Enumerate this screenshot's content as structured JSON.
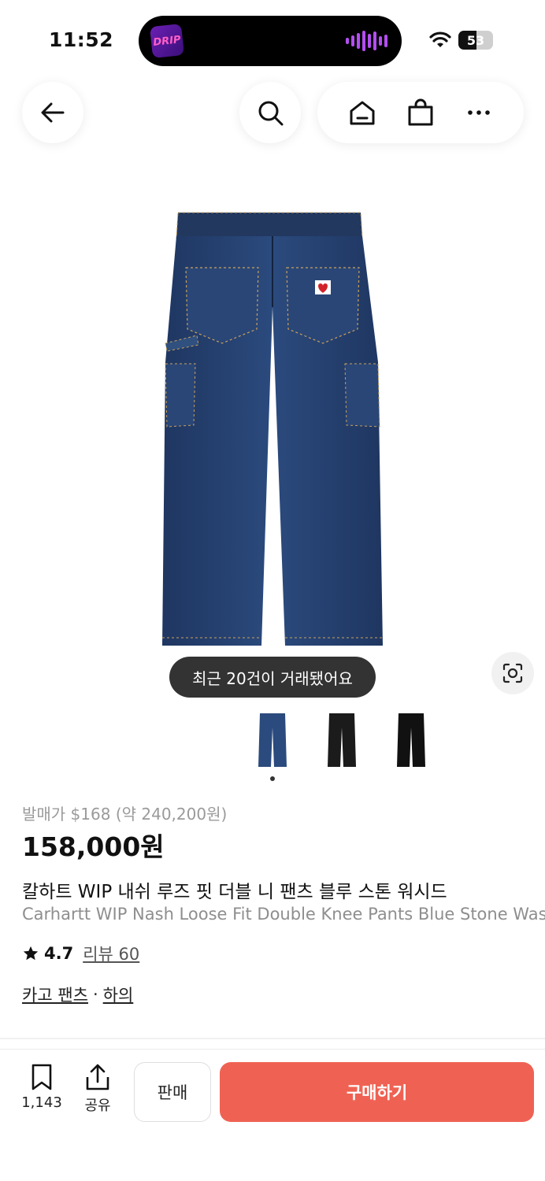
{
  "status_bar": {
    "time": "11:52",
    "island_app": "DRIP",
    "battery_percent": 53,
    "battery_text": "53"
  },
  "nav": {
    "back_icon": "arrow-left-icon",
    "search_icon": "search-icon",
    "home_icon": "home-icon",
    "cart_icon": "shopping-bag-icon",
    "more_icon": "more-horizontal-icon"
  },
  "product": {
    "toast": "최근 20건이 거래됐어요",
    "thumbnails": [
      "blue",
      "black",
      "black"
    ],
    "release_price": "발매가 $168 (약 240,200원)",
    "price": "158,000원",
    "name_ko": "칼하트 WIP 내쉬 루즈 핏 더블 니 팬츠 블루 스톤 워시드",
    "name_en": "Carhartt WIP Nash Loose Fit Double Knee Pants Blue Stone Washed",
    "rating": "4.7",
    "reviews": "리뷰 60",
    "category": "카고 팬츠",
    "category_sep": "·",
    "category2": "하의"
  },
  "bottom_bar": {
    "bookmark_count": "1,143",
    "share_label": "공유",
    "sell_label": "판매",
    "buy_label": "구매하기",
    "buy_color": "#ef6253"
  }
}
